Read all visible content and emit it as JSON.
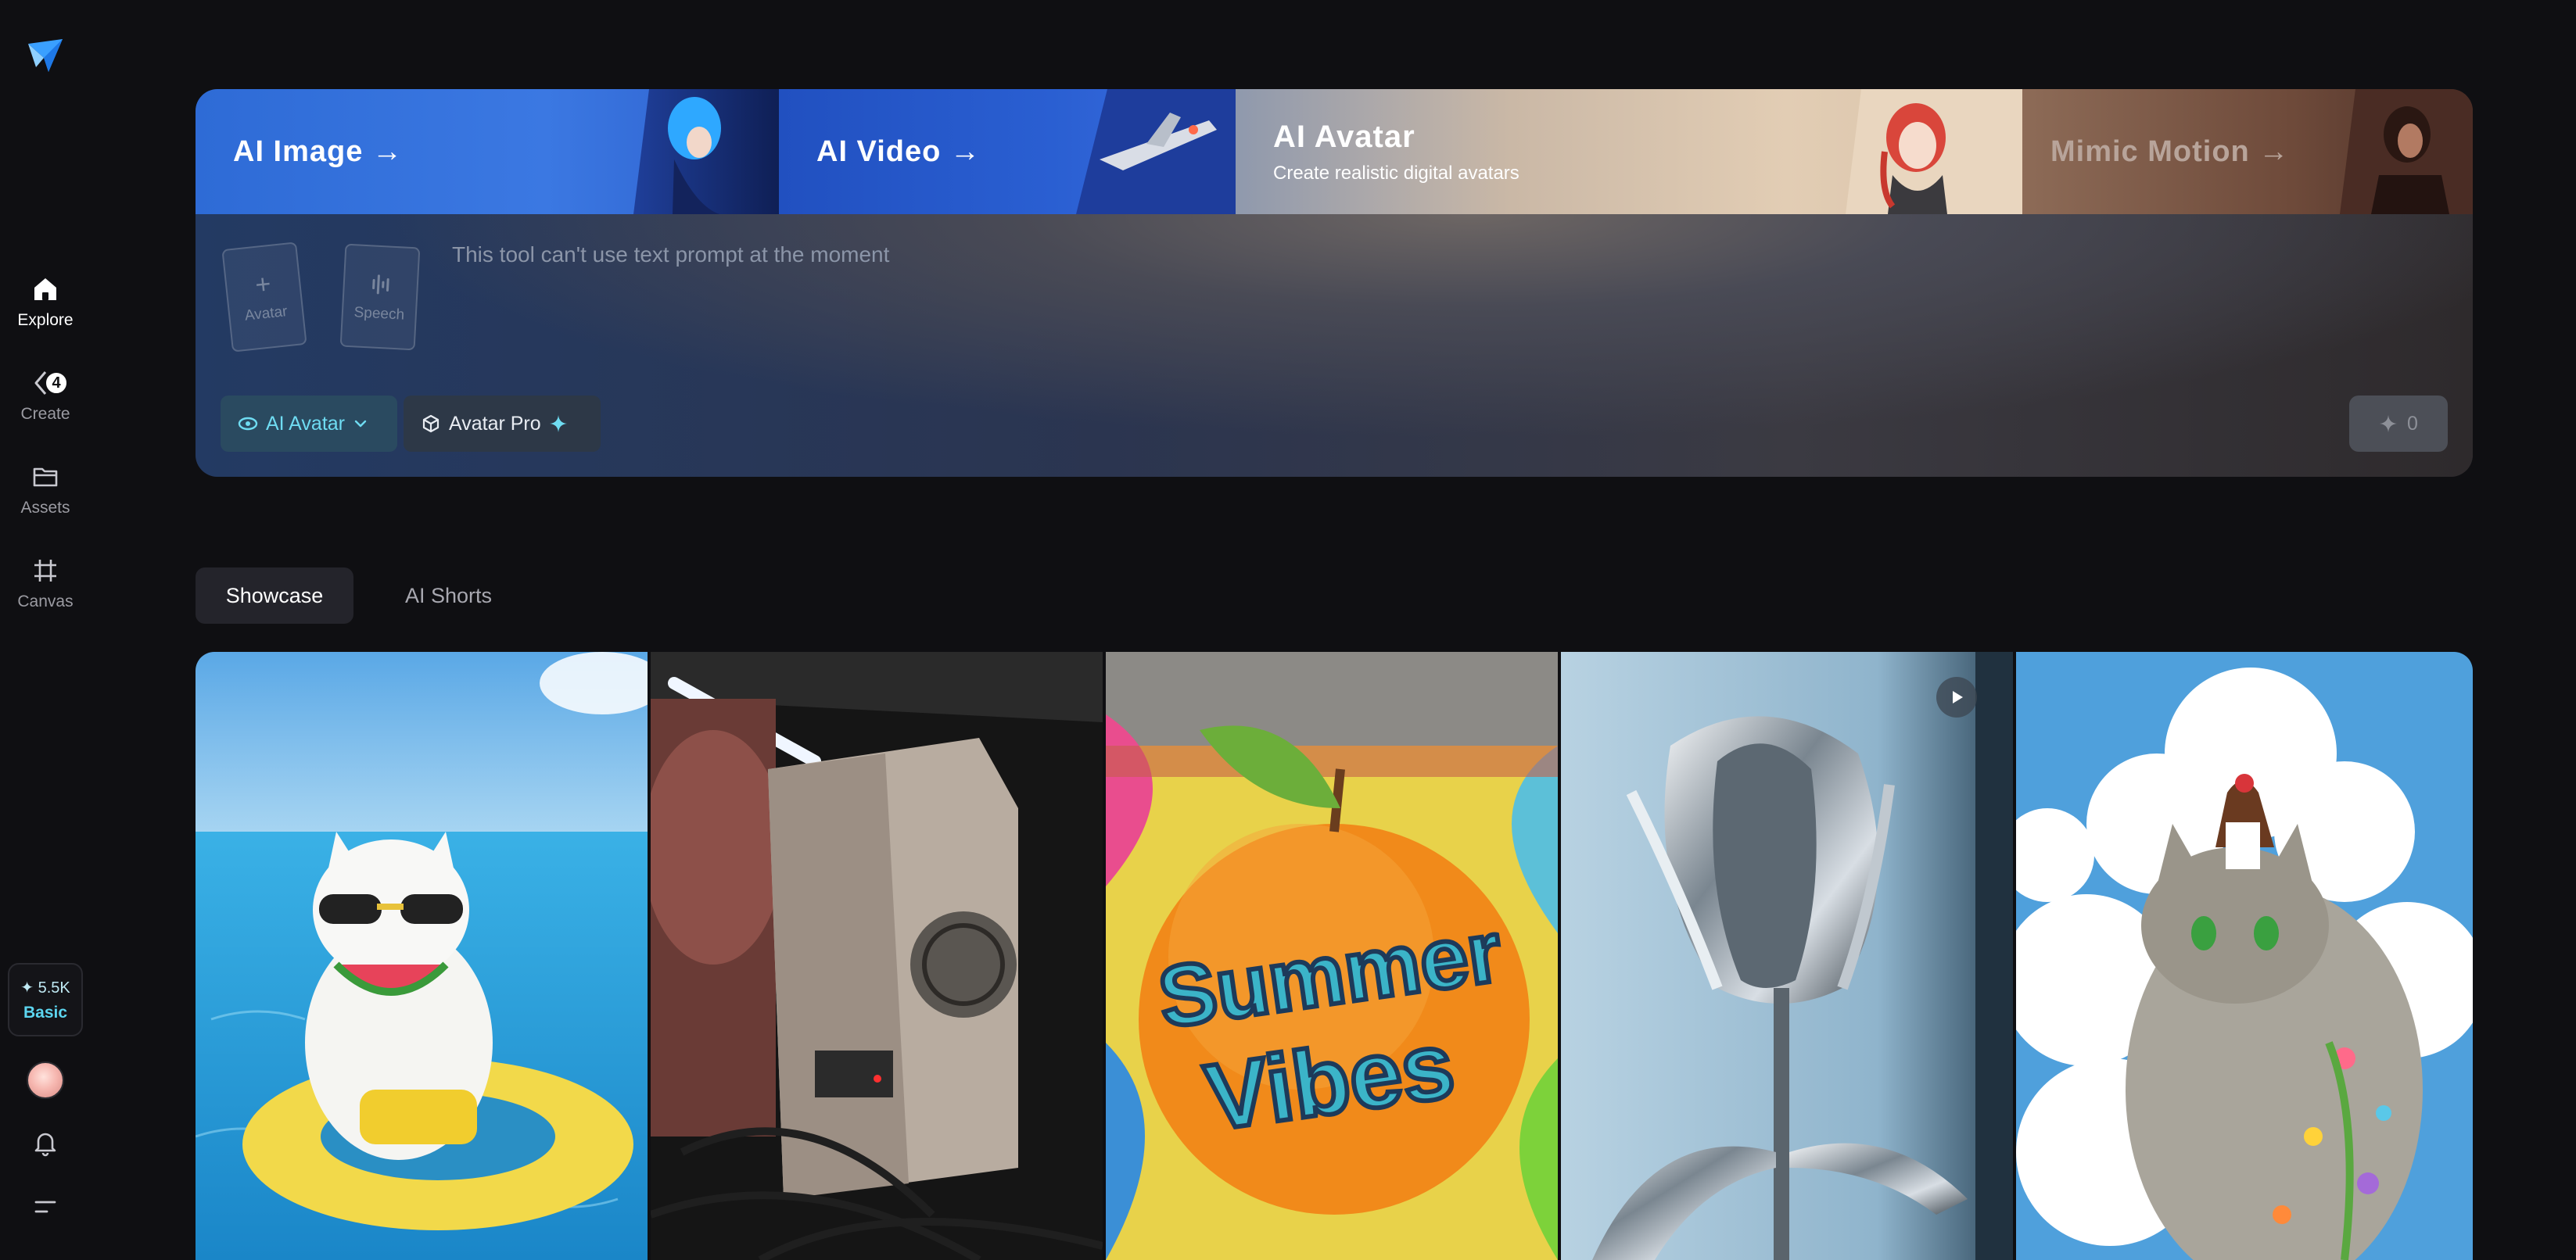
{
  "sidebar": {
    "items": [
      {
        "label": "Explore",
        "icon": "home-icon"
      },
      {
        "label": "Create",
        "icon": "create-icon",
        "badge": "4"
      },
      {
        "label": "Assets",
        "icon": "folder-icon"
      },
      {
        "label": "Canvas",
        "icon": "canvas-icon"
      }
    ],
    "credits": {
      "amount": "✦ 5.5K",
      "plan": "Basic"
    }
  },
  "tool_tabs": [
    {
      "label": "AI Image →"
    },
    {
      "label": "AI Video →"
    },
    {
      "label": "AI Avatar",
      "subtitle": "Create realistic digital avatars"
    },
    {
      "label": "Mimic Motion →"
    }
  ],
  "tool_panel": {
    "slots": [
      {
        "label": "Avatar"
      },
      {
        "label": "Speech"
      }
    ],
    "prompt_placeholder": "This tool can't use text prompt at the moment",
    "mode_pill": "AI Avatar",
    "model_pill": "Avatar Pro",
    "credit_cost": "0"
  },
  "gallery": {
    "tabs": [
      {
        "label": "Showcase"
      },
      {
        "label": "AI Shorts"
      }
    ],
    "items": [
      {
        "alt": "white cat with sunglasses eating watermelon on pool float"
      },
      {
        "alt": "fleshy mechanical machine in dark room"
      },
      {
        "alt": "orange with Summer Vibes graffiti text"
      },
      {
        "alt": "chrome metallic tulip",
        "video": true
      },
      {
        "alt": "anime girl standing on giant flower cat in clouds"
      }
    ]
  },
  "colors": {
    "background": "#0f0f12",
    "accent": "#5cd5ef",
    "panel": "#1b1f2a"
  }
}
